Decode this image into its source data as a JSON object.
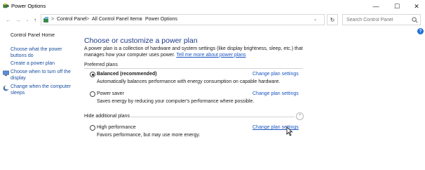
{
  "window": {
    "title": "Power Options",
    "minimize": "—",
    "maximize": "☐",
    "close": "✕"
  },
  "nav": {
    "back": "←",
    "forward": "→",
    "recent": "⌄",
    "up": "↑",
    "dropdown": "⌄",
    "refresh": "↻"
  },
  "breadcrumb": {
    "items": [
      "Control Panel",
      "All Control Panel Items",
      "Power Options"
    ],
    "separator": ">"
  },
  "search": {
    "placeholder": "Search Control Panel"
  },
  "help": {
    "label": "?"
  },
  "sidebar": {
    "home": "Control Panel Home",
    "items": [
      {
        "label": "Choose what the power buttons do",
        "icon": "none"
      },
      {
        "label": "Create a power plan",
        "icon": "none"
      },
      {
        "label": "Choose when to turn off the display",
        "icon": "monitor-icon"
      },
      {
        "label": "Change when the computer sleeps",
        "icon": "moon-icon"
      }
    ]
  },
  "main": {
    "title": "Choose or customize a power plan",
    "description": "A power plan is a collection of hardware and system settings (like display brightness, sleep, etc.) that manages how your computer uses power.",
    "description_link": "Tell me more about power plans",
    "preferred_label": "Preferred plans",
    "additional_label": "Hide additional plans",
    "change_label": "Change plan settings",
    "collapse_icon": "⌃",
    "plans": [
      {
        "name": "Balanced (recommended)",
        "description": "Automatically balances performance with energy consumption on capable hardware.",
        "selected": true
      },
      {
        "name": "Power saver",
        "description": "Saves energy by reducing your computer's performance where possible.",
        "selected": false
      },
      {
        "name": "High performance",
        "description": "Favors performance, but may use more energy.",
        "selected": false
      }
    ]
  },
  "colors": {
    "title_blue": "#1e3a8a",
    "link_blue": "#1a56c2",
    "help_blue": "#1f6fd1"
  }
}
